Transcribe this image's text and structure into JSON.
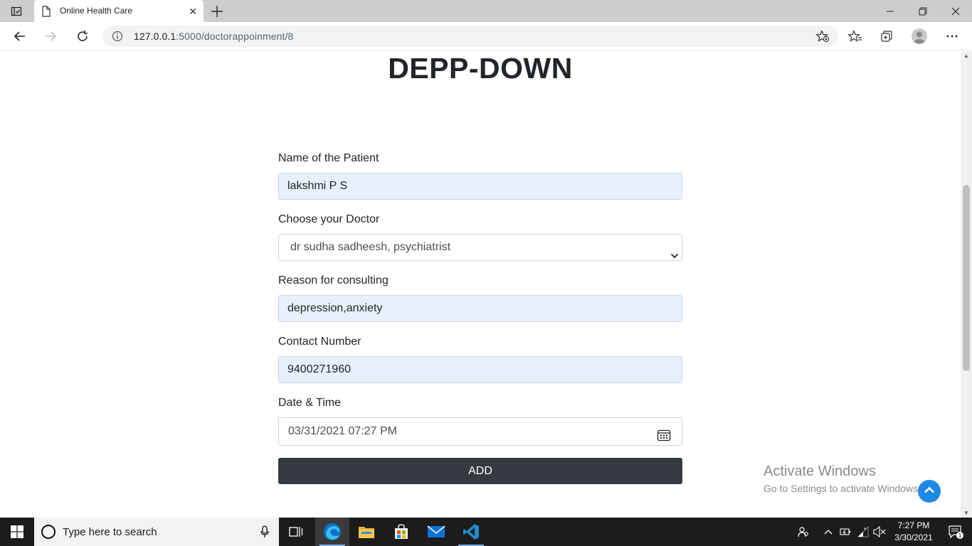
{
  "browser": {
    "tab_title": "Online Health Care",
    "tab_close": "✕",
    "url_host": "127.0.0.1",
    "url_path": ":5000/doctorappoinment/8",
    "icons": [
      "tab-actions-icon",
      "page-icon",
      "close-icon",
      "plus-icon",
      "minimize-icon",
      "restore-icon",
      "close-window-icon",
      "back-arrow-icon",
      "forward-arrow-icon",
      "refresh-icon",
      "info-icon",
      "add-favorite-icon",
      "favorites-icon",
      "collections-icon",
      "profile-icon",
      "more-icon"
    ]
  },
  "page": {
    "title": "DEPP-DOWN",
    "form": {
      "patient_label": "Name of the Patient",
      "patient_value": "lakshmi P S",
      "doctor_label": "Choose your Doctor",
      "doctor_value": "dr sudha sadheesh, psychiatrist",
      "reason_label": "Reason for consulting",
      "reason_value": "depression,anxiety",
      "contact_label": "Contact Number",
      "contact_value": "9400271960",
      "datetime_label": "Date & Time",
      "datetime_value": "03/31/2021 07:27 PM",
      "submit_label": "ADD"
    },
    "watermark_title": "Activate Windows",
    "watermark_sub": "Go to Settings to activate Windows."
  },
  "taskbar": {
    "search_placeholder": "Type here to search",
    "time": "7:27 PM",
    "date": "3/30/2021",
    "notification_count": "1",
    "accent_color": "#7fb2e5"
  }
}
